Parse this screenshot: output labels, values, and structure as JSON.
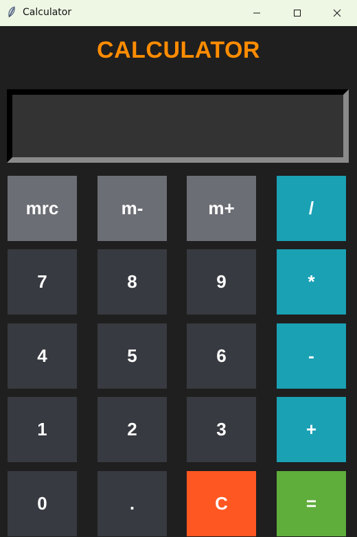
{
  "window": {
    "title": "Calculator",
    "icon": "feather-icon",
    "controls": {
      "minimize_icon": "minimize-icon",
      "maximize_icon": "maximize-icon",
      "close_icon": "close-icon"
    }
  },
  "header": {
    "title": "CALCULATOR"
  },
  "display": {
    "value": ""
  },
  "keys": {
    "mrc": "mrc",
    "m_minus": "m-",
    "m_plus": "m+",
    "divide": "/",
    "seven": "7",
    "eight": "8",
    "nine": "9",
    "multiply": "*",
    "four": "4",
    "five": "5",
    "six": "6",
    "subtract": "-",
    "one": "1",
    "two": "2",
    "three": "3",
    "add": "+",
    "zero": "0",
    "decimal": ".",
    "clear": "C",
    "equals": "="
  },
  "colors": {
    "background": "#1f1f1f",
    "title": "#ff8c00",
    "display_bg": "#333333",
    "memory_key": "#6b6e74",
    "digit_key": "#373a40",
    "operator_key": "#1aa1b4",
    "clear_key": "#ff5722",
    "equals_key": "#5fad3b",
    "key_text": "#ffffff"
  }
}
